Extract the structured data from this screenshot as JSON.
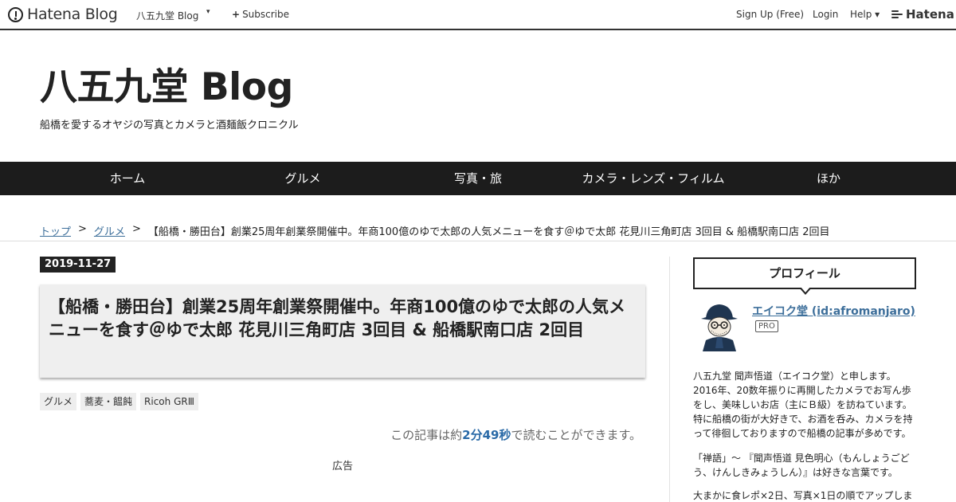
{
  "topbar": {
    "logo_text": "Hatena Blog",
    "blog_name": "八五九堂 Blog",
    "caret": "▾",
    "subscribe_icon": "+",
    "subscribe_label": "Subscribe",
    "signup": "Sign Up (Free)",
    "login": "Login",
    "help": "Help ▾",
    "hatena": "Hatena"
  },
  "header": {
    "title": "八五九堂 Blog",
    "description": "船橋を愛するオヤジの写真とカメラと酒麺飯クロニクル"
  },
  "nav": {
    "items": [
      "ホーム",
      "グルメ",
      "写真・旅",
      "カメラ・レンズ・フィルム",
      "ほか"
    ]
  },
  "breadcrumb": {
    "top": "トップ",
    "sep": ">",
    "category": "グルメ",
    "current": "【船橋・勝田台】創業25周年創業祭開催中。年商100億のゆで太郎の人気メニューを食す＠ゆで太郎 花見川三角町店 3回目 & 船橋駅南口店 2回目"
  },
  "article": {
    "date": "2019-11-27",
    "title": "【船橋・勝田台】創業25周年創業祭開催中。年商100億のゆで太郎の人気メニューを食す＠ゆで太郎 花見川三角町店 3回目 & 船橋駅南口店 2回目",
    "categories": [
      "グルメ",
      "蕎麦・饂飩",
      "Ricoh GRⅢ"
    ],
    "readtime_prefix": "この記事は約",
    "readtime_value": "2分49秒",
    "readtime_suffix": "で読むことができます。",
    "ad_label": "広告"
  },
  "sidebar": {
    "profile_heading": "プロフィール",
    "name": "エイコク堂 (id:afromanjaro)",
    "badge": "PRO",
    "para1": "八五九堂 聞声悟道（エイコク堂）と申します。2016年、20数年振りに再開したカメラでお写ん歩をし、美味しいお店（主にＢ級）を訪ねています。特に船橋の街が大好きで、お酒を呑み、カメラを持って徘徊しておりますので船橋の記事が多めです。",
    "para2": "「禅語」～ 『聞声悟道 見色明心（もんしょうごどう、けんしきみょうしん）』は好きな言葉です。",
    "para3": "大まかに食レポ×2日、写真×1日の順でアップしま"
  }
}
